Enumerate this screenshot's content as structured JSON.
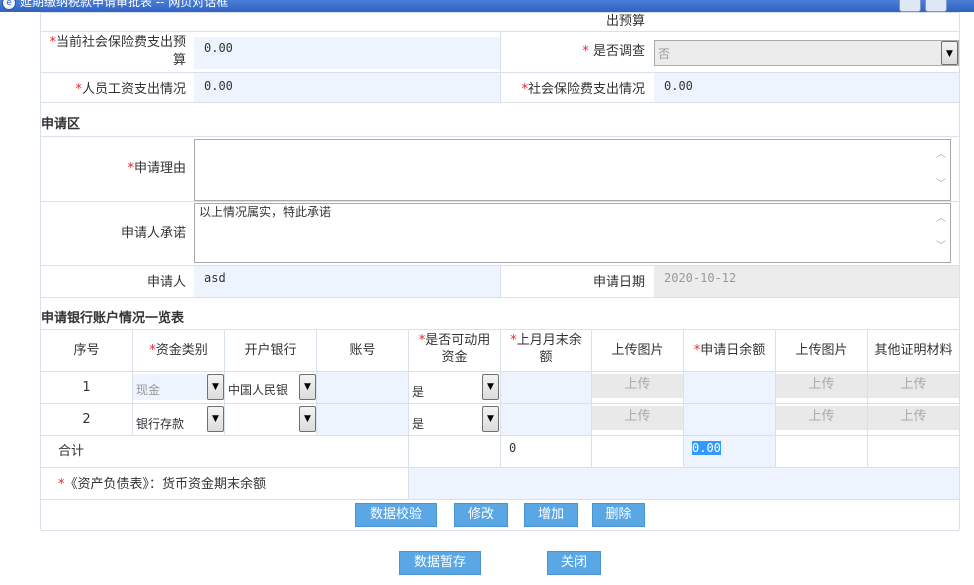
{
  "window": {
    "title": "延期缴纳税款申请审批表 -- 网页对话框"
  },
  "basic": {
    "top_label_tail": "出预算",
    "social_budget_label": "当前社会保险费支出预算",
    "social_budget_value": "0.00",
    "investigate_label": "是否调查",
    "investigate_value": "否",
    "salary_label": "人员工资支出情况",
    "salary_value": "0.00",
    "social_label": "社会保险费支出情况",
    "social_value": "0.00"
  },
  "apply": {
    "section_title": "申请区",
    "reason_label": "申请理由",
    "reason_value": "",
    "promise_label": "申请人承诺",
    "promise_value": "以上情况属实，特此承诺",
    "applicant_label": "申请人",
    "applicant_value": "asd",
    "date_label": "申请日期",
    "date_value": "2020-10-12"
  },
  "bank": {
    "section_title": "申请银行账户情况一览表",
    "headers": {
      "seq": "序号",
      "fund_type": "资金类别",
      "bank": "开户银行",
      "account": "账号",
      "usable_1": "是否可动用",
      "usable_2": "资金",
      "balance_1": "上月月末余",
      "balance_2": "额",
      "upload1": "上传图片",
      "apply_balance": "申请日余额",
      "upload2": "上传图片",
      "other": "其他证明材料"
    },
    "rows": [
      {
        "seq": "1",
        "fund_type": "现金",
        "bank": "中国人民银",
        "usable": "是",
        "upload": "上传"
      },
      {
        "seq": "2",
        "fund_type": "银行存款",
        "bank": "",
        "usable": "是",
        "upload": "上传"
      }
    ],
    "total_label": "合计",
    "total_balance": "0",
    "total_apply": "0.00",
    "assets_label": "《资产负债表》：货币资金期末余额"
  },
  "buttons": {
    "validate": "数据校验",
    "modify": "修改",
    "add": "增加",
    "delete": "删除",
    "save": "数据暂存",
    "close": "关闭"
  }
}
